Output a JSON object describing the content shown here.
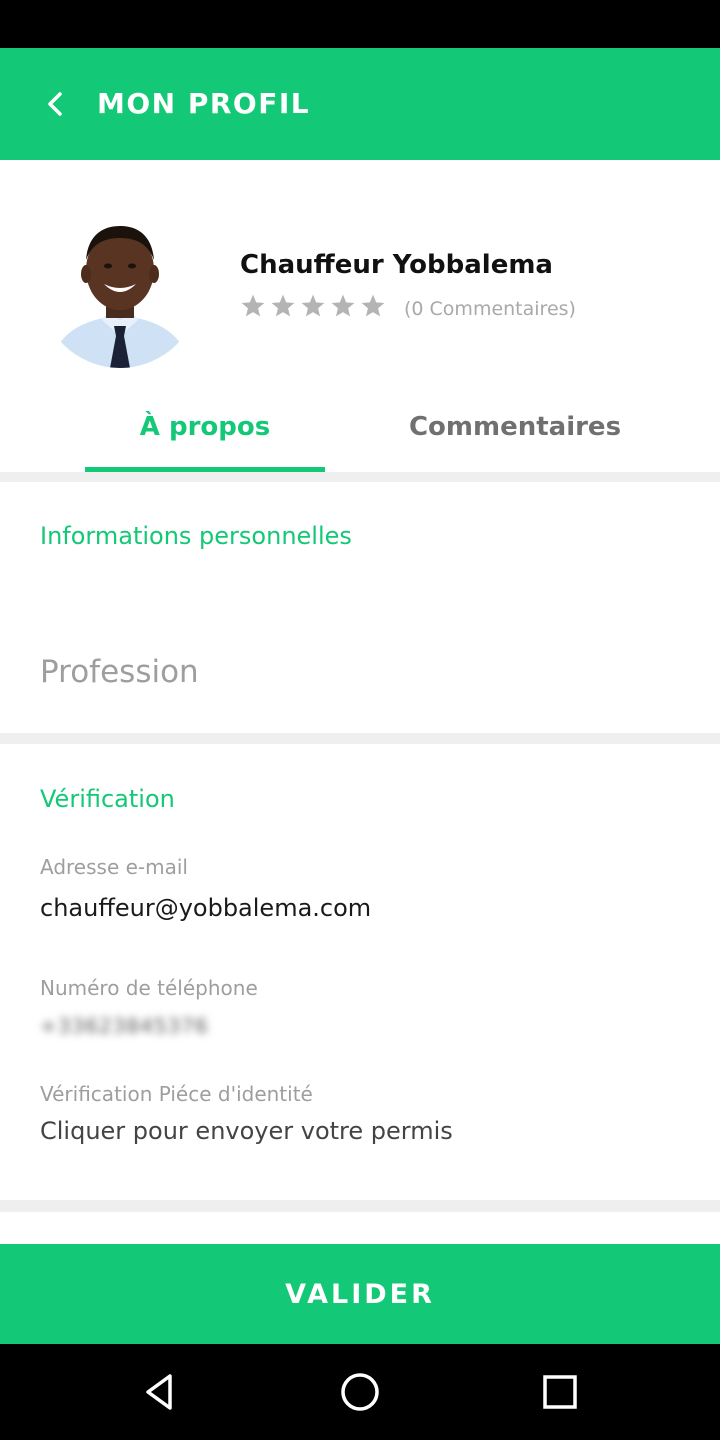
{
  "header": {
    "title": "MON PROFIL",
    "back_icon": "chevron-left-icon"
  },
  "profile": {
    "name": "Chauffeur Yobbalema",
    "rating": 0,
    "rating_max": 5,
    "review_count": "(0 Commentaires)"
  },
  "tabs": [
    {
      "label": "À propos",
      "active": true
    },
    {
      "label": "Commentaires",
      "active": false
    }
  ],
  "personal": {
    "section_title": "Informations personnelles",
    "profession_placeholder": "Profession"
  },
  "verification": {
    "section_title": "Vérification",
    "email_label": "Adresse e-mail",
    "email_value": "chauffeur@yobbalema.com",
    "phone_label": "Numéro de téléphone",
    "phone_value": "+33623845376",
    "id_label": "Vérification Piéce d'identité",
    "id_action": "Cliquer pour envoyer votre permis"
  },
  "cta": {
    "label": "VALIDER"
  },
  "colors": {
    "accent": "#13c876",
    "muted": "#9e9e9e",
    "divider": "#efefef"
  },
  "system_nav": {
    "back_icon": "triangle-back-icon",
    "home_icon": "circle-home-icon",
    "recents_icon": "square-recents-icon"
  }
}
